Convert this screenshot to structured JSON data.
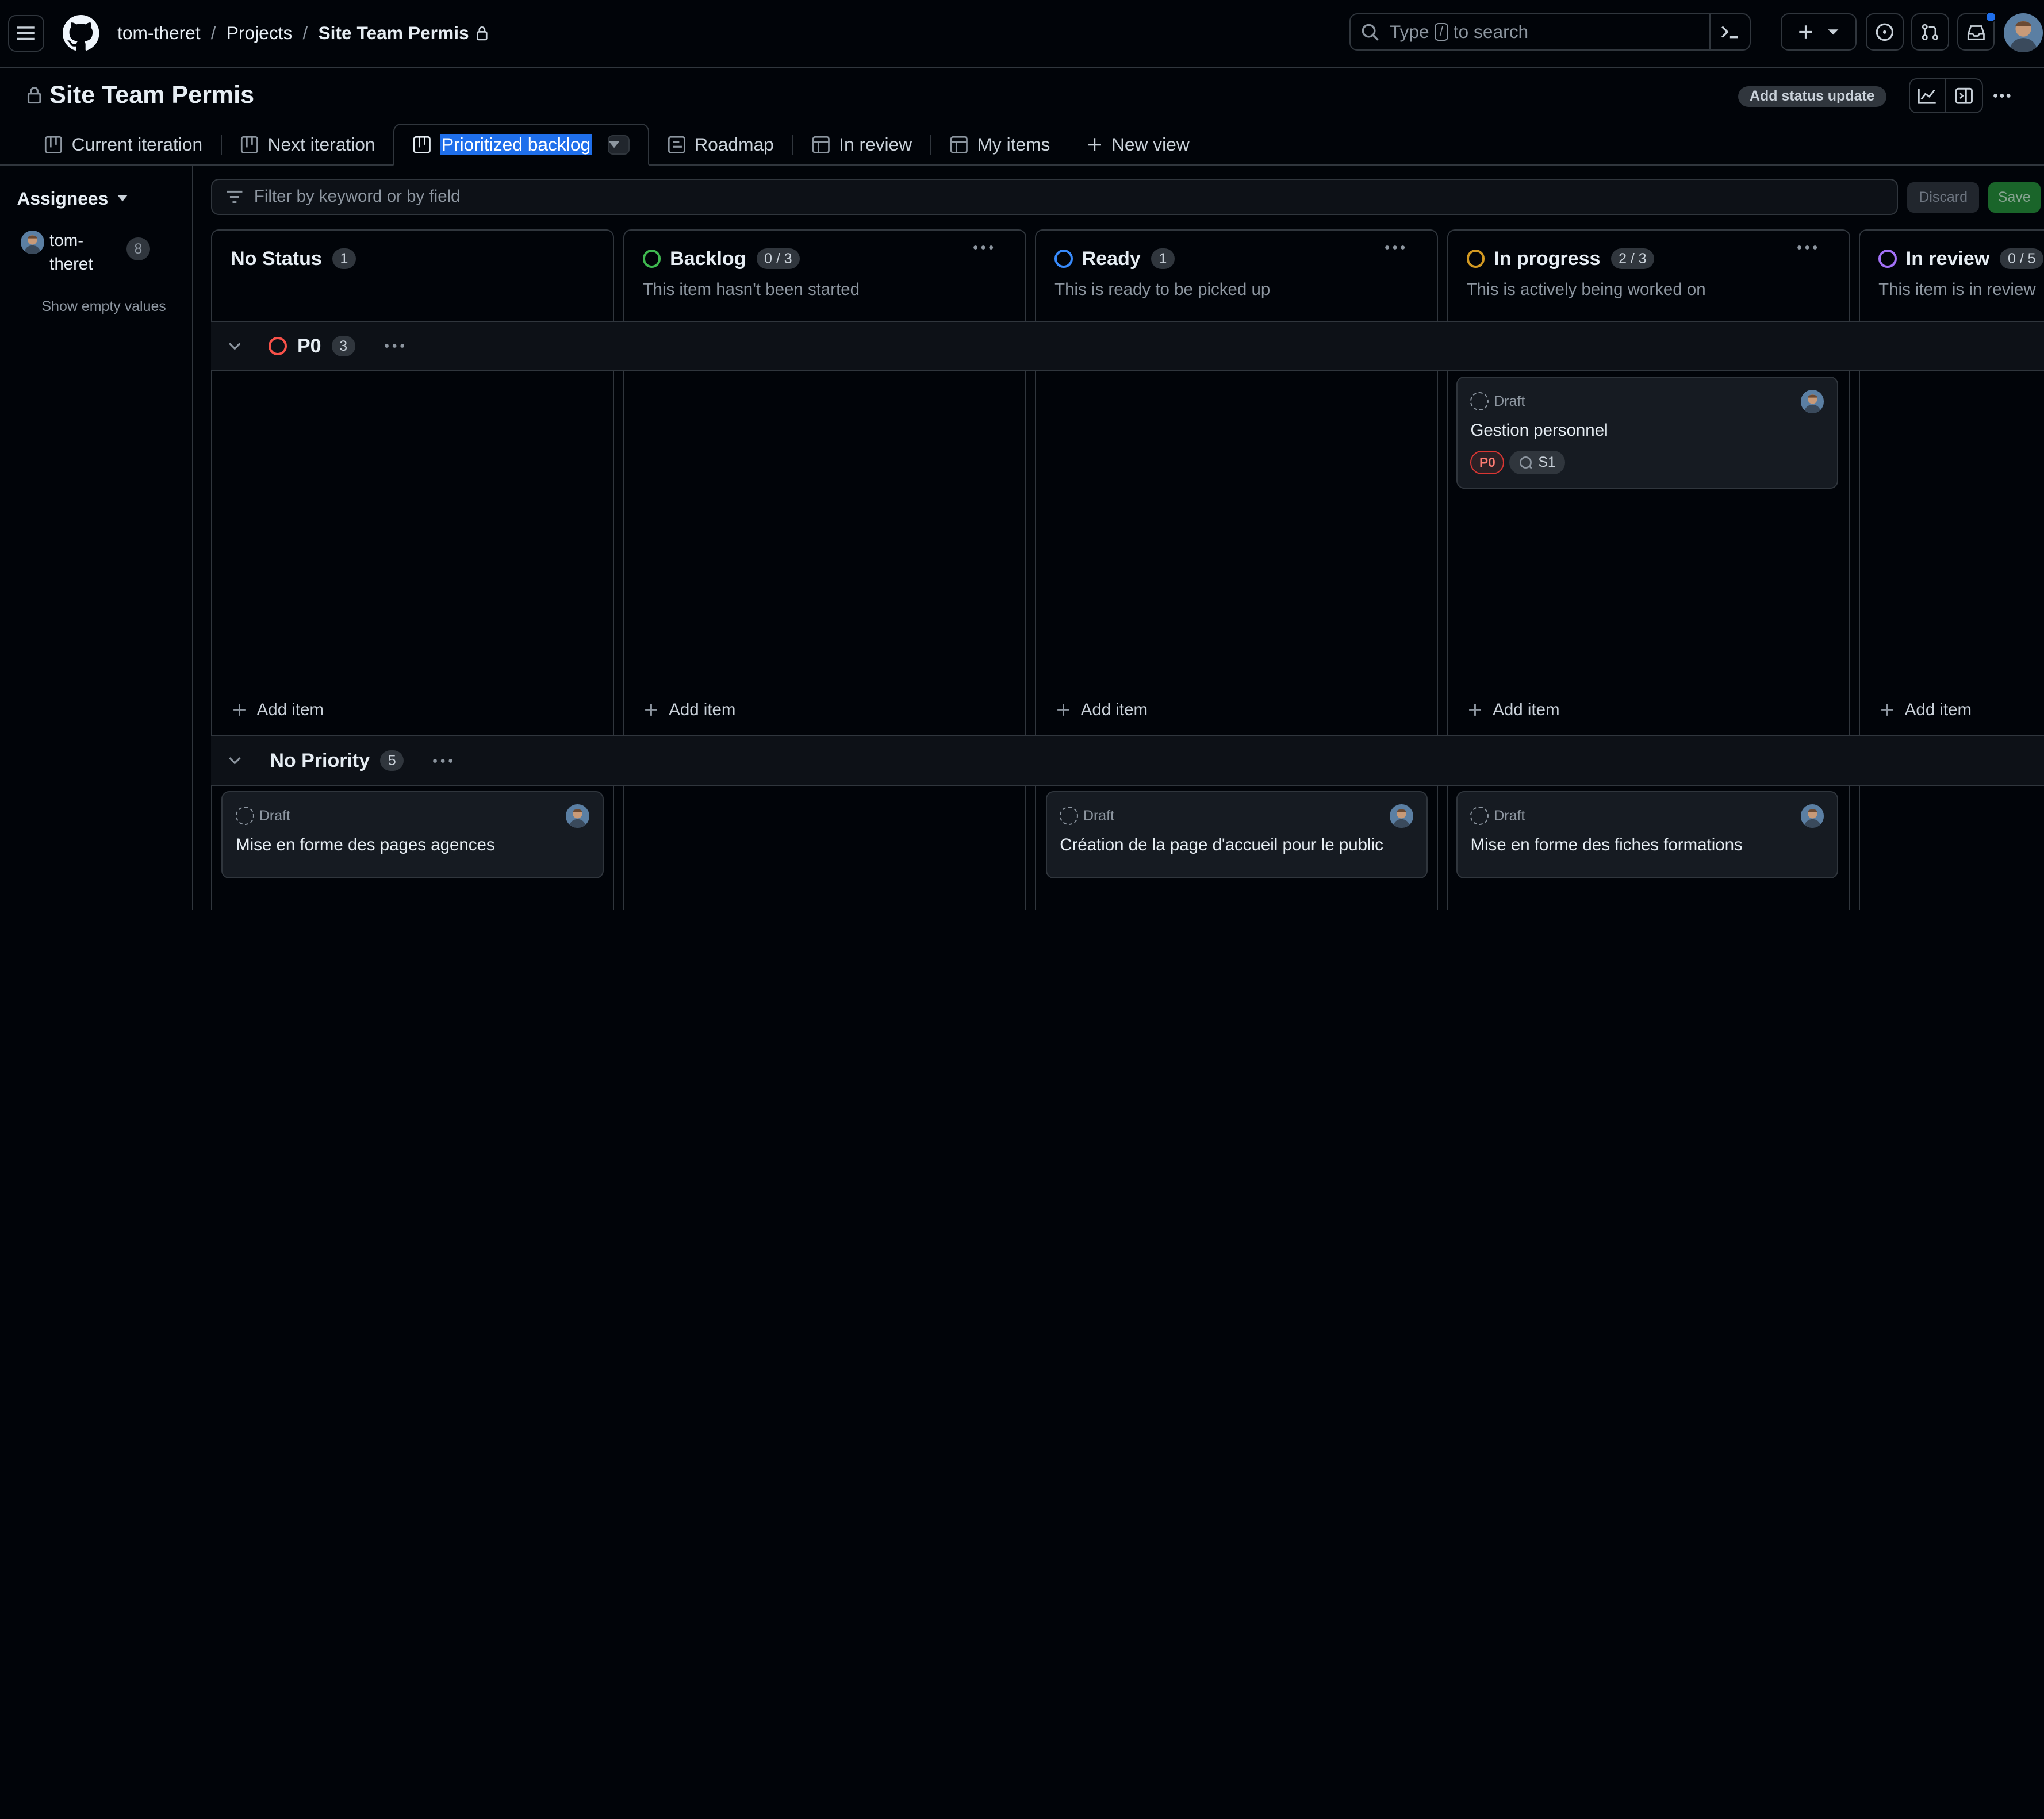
{
  "header": {
    "owner": "tom-theret",
    "projects": "Projects",
    "project": "Site Team Permis",
    "search_prefix": "Type",
    "search_key": "/",
    "search_suffix": "to search"
  },
  "project": {
    "title": "Site Team Permis",
    "status_update": "Add status update"
  },
  "tabs": [
    {
      "label": "Current iteration",
      "icon": "board-icon"
    },
    {
      "label": "Next iteration",
      "icon": "board-icon"
    },
    {
      "label": "Prioritized backlog",
      "icon": "board-icon",
      "active": true
    },
    {
      "label": "Roadmap",
      "icon": "roadmap-icon"
    },
    {
      "label": "In review",
      "icon": "table-icon"
    },
    {
      "label": "My items",
      "icon": "table-icon"
    },
    {
      "label": "New view",
      "icon": "plus-icon"
    }
  ],
  "sidebar": {
    "heading": "Assignees",
    "user_name": "tom-\ntheret",
    "user_count": "8",
    "show_empty": "Show empty values"
  },
  "filter": {
    "placeholder": "Filter by keyword or by field",
    "discard": "Discard",
    "save": "Save"
  },
  "columns": [
    {
      "title": "No Status",
      "count": "1",
      "description": "",
      "color": ""
    },
    {
      "title": "Backlog",
      "count": "0 / 3",
      "description": "This item hasn't been started",
      "color": "#3fb950"
    },
    {
      "title": "Ready",
      "count": "1",
      "description": "This is ready to be picked up",
      "color": "#388bfd"
    },
    {
      "title": "In progress",
      "count": "2 / 3",
      "description": "This is actively being worked on",
      "color": "#d29922"
    },
    {
      "title": "In review",
      "count": "0 / 5",
      "description": "This item is in review",
      "color": "#a371f7"
    }
  ],
  "groups": [
    {
      "name": "P0",
      "count": "3",
      "color": "#f85149"
    },
    {
      "name": "No Priority",
      "count": "5"
    }
  ],
  "add_item": "Add item",
  "cards": {
    "p0_inprogress": {
      "type": "Draft",
      "title": "Gestion personnel",
      "priority": "P0",
      "iteration": "S1"
    },
    "np_nostatus": {
      "type": "Draft",
      "title": "Mise en forme des pages agences"
    },
    "np_ready": {
      "type": "Draft",
      "title": "Création de la page d'accueil pour le public"
    },
    "np_inprogress": {
      "type": "Draft",
      "title": "Mise en forme des fiches formations"
    }
  }
}
